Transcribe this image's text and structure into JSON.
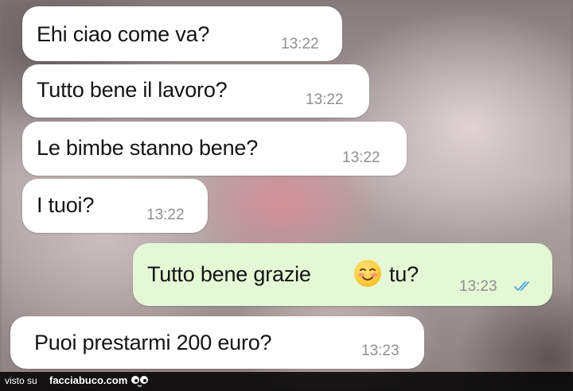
{
  "messages": [
    {
      "text": "Ehi ciao come va?",
      "time": "13:22",
      "direction": "incoming"
    },
    {
      "text": "Tutto bene il lavoro?",
      "time": "13:22",
      "direction": "incoming"
    },
    {
      "text": "Le bimbe stanno bene?",
      "time": "13:22",
      "direction": "incoming"
    },
    {
      "text": "I tuoi?",
      "time": "13:22",
      "direction": "incoming"
    },
    {
      "text_before": "Tutto bene grazie",
      "emoji": "smiling-face-with-blush-icon",
      "text_after": "tu?",
      "time": "13:23",
      "direction": "outgoing",
      "status_icon": "double-check-read-icon"
    },
    {
      "text": "Puoi prestarmi 200 euro?",
      "time": "13:23",
      "direction": "incoming"
    }
  ],
  "footer": {
    "visto_label": "visto su",
    "brand": "facciabuco.com",
    "logo_icon": "eyes-logo-icon"
  },
  "colors": {
    "incoming_bubble": "#ffffff",
    "outgoing_bubble": "#e4f8d5",
    "timestamp": "#8f8f8f",
    "read_ticks": "#4fa3e0",
    "footer_bg": "#000000"
  }
}
